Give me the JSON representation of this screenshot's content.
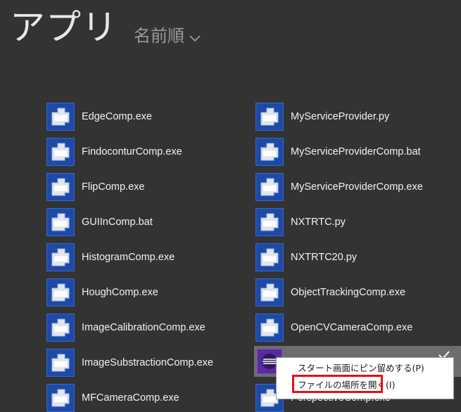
{
  "header": {
    "title": "アプリ",
    "sort_label": "名前順"
  },
  "apps_left": [
    {
      "label": "EdgeComp.exe"
    },
    {
      "label": "FindoconturComp.exe"
    },
    {
      "label": "FlipComp.exe"
    },
    {
      "label": "GUIInComp.bat"
    },
    {
      "label": "HistogramComp.exe"
    },
    {
      "label": "HoughComp.exe"
    },
    {
      "label": "ImageCalibrationComp.exe"
    },
    {
      "label": "ImageSubstractionComp.exe"
    },
    {
      "label": "MFCameraComp.exe"
    }
  ],
  "apps_right": [
    {
      "label": "MyServiceProvider.py"
    },
    {
      "label": "MyServiceProviderComp.bat"
    },
    {
      "label": "MyServiceProviderComp.exe"
    },
    {
      "label": "NXTRTC.py"
    },
    {
      "label": "NXTRTC20.py"
    },
    {
      "label": "ObjectTrackingComp.exe"
    },
    {
      "label": "OpenCVCameraComp.exe"
    },
    {
      "label": "PerspectiveComp.exe"
    }
  ],
  "context_menu": {
    "items": [
      {
        "label": "スタート画面にピン留めする(P)"
      },
      {
        "label": "ファイルの場所を開く(I)"
      }
    ]
  },
  "colors": {
    "background": "#333333",
    "tile_blue": "#1d4aa8",
    "tile_purple": "#5a2aa0",
    "selection": "#6d6d6d",
    "highlight_box": "#e0101a"
  }
}
